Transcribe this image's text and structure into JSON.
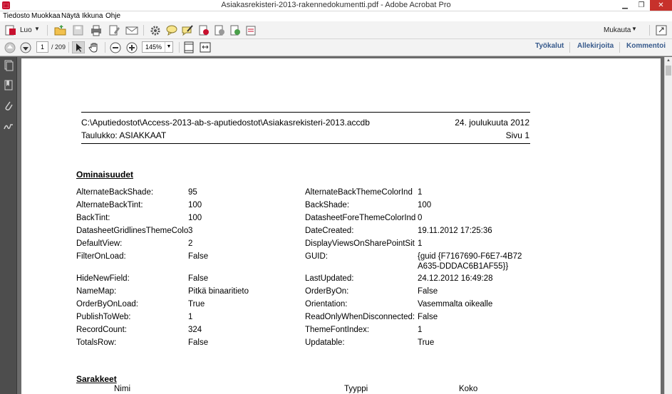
{
  "window": {
    "title": "Asiakasrekisteri-2013-rakennedokumentti.pdf - Adobe Acrobat Pro",
    "app_icon": "acrobat-icon"
  },
  "menu": {
    "items": [
      "Tiedosto",
      "Muokkaa",
      "Näytä",
      "Ikkuna",
      "Ohje"
    ]
  },
  "toolbar": {
    "create_label": "Luo",
    "customize_label": "Mukauta",
    "page_current": "1",
    "page_total": "/ 209",
    "zoom": "145%",
    "pane_tools": "Työkalut",
    "pane_sign": "Allekirjoita",
    "pane_comment": "Kommentoi"
  },
  "document": {
    "path": "C:\\Aputiedostot\\Access-2013-ab-s-aputiedostot\\Asiakasrekisteri-2013.accdb",
    "date": "24. joulukuuta 2012",
    "table": "Taulukko: ASIAKKAAT",
    "page": "Sivu 1",
    "section_properties": "Ominaisuudet",
    "section_columns": "Sarakkeet",
    "columns_header": {
      "name": "Nimi",
      "type": "Tyyppi",
      "size": "Koko"
    },
    "props_left": [
      {
        "k": "AlternateBackShade:",
        "v": "95"
      },
      {
        "k": "AlternateBackTint:",
        "v": "100"
      },
      {
        "k": "BackTint:",
        "v": "100"
      },
      {
        "k": "DatasheetGridlinesThemeColo",
        "v": "3"
      },
      {
        "k": "DefaultView:",
        "v": "2"
      },
      {
        "k": "FilterOnLoad:",
        "v": "False"
      },
      {
        "k": "HideNewField:",
        "v": "False"
      },
      {
        "k": "NameMap:",
        "v": "Pitkä binaaritieto"
      },
      {
        "k": "OrderByOnLoad:",
        "v": "True"
      },
      {
        "k": "PublishToWeb:",
        "v": "1"
      },
      {
        "k": "RecordCount:",
        "v": "324"
      },
      {
        "k": "TotalsRow:",
        "v": "False"
      }
    ],
    "props_right": [
      {
        "k": "AlternateBackThemeColorInd",
        "v": "1"
      },
      {
        "k": "BackShade:",
        "v": "100"
      },
      {
        "k": "DatasheetForeThemeColorInd",
        "v": "0"
      },
      {
        "k": "DateCreated:",
        "v": "19.11.2012 17:25:36"
      },
      {
        "k": "DisplayViewsOnSharePointSit",
        "v": "1"
      },
      {
        "k": "GUID:",
        "v": "{guid {F7167690-F6E7-4B72",
        "v2": "A635-DDDAC6B1AF55}}"
      },
      {
        "k": "LastUpdated:",
        "v": "24.12.2012 16:49:28"
      },
      {
        "k": "OrderByOn:",
        "v": "False"
      },
      {
        "k": "Orientation:",
        "v": "Vasemmalta oikealle"
      },
      {
        "k": "ReadOnlyWhenDisconnected:",
        "v": "False"
      },
      {
        "k": "ThemeFontIndex:",
        "v": "1"
      },
      {
        "k": "Updatable:",
        "v": "True"
      }
    ]
  }
}
